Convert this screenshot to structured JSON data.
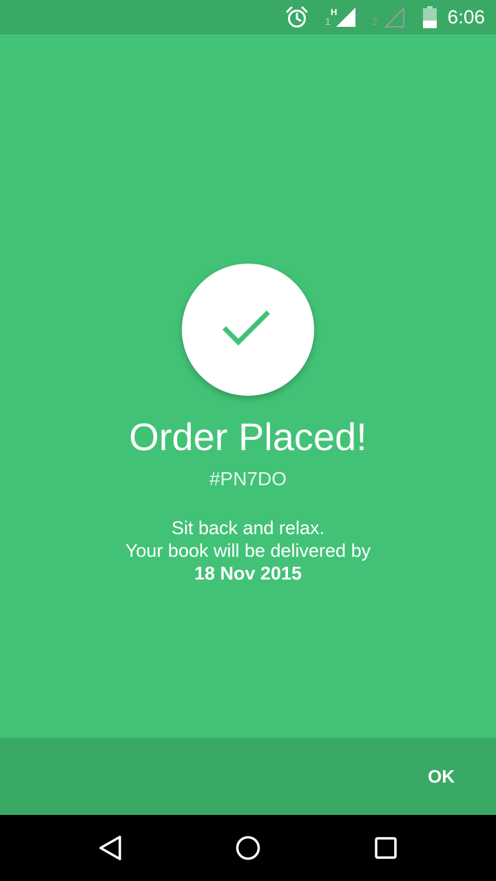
{
  "status_bar": {
    "time": "6:06",
    "icons": [
      "alarm-icon",
      "signal-sim1-icon",
      "signal-sim2-icon",
      "battery-icon"
    ],
    "sim1_label": "1",
    "sim1_network": "H",
    "sim2_label": "2"
  },
  "confirmation": {
    "icon": "checkmark-icon",
    "title": "Order Placed!",
    "order_id": "#PN7DO",
    "message_line1": "Sit back and relax.",
    "message_line2": "Your book will be delivered by",
    "delivery_date": "18 Nov 2015"
  },
  "actions": {
    "ok_label": "OK"
  },
  "navigation": {
    "icons": [
      "back-icon",
      "home-icon",
      "recents-icon"
    ]
  },
  "colors": {
    "background": "#42c277",
    "bar_background": "#3aa966",
    "check": "#42c277",
    "text": "#ffffff"
  }
}
